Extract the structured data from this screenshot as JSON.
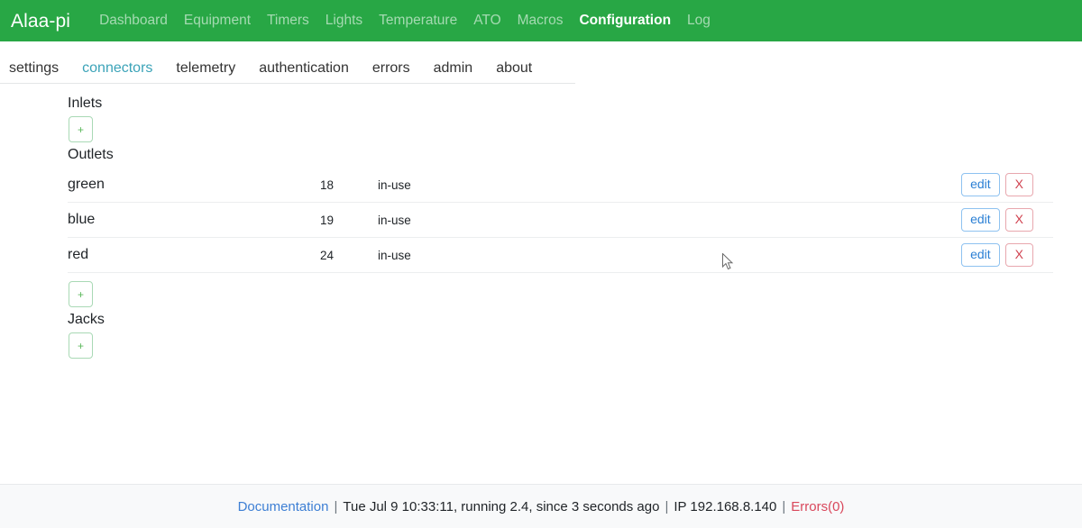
{
  "app": {
    "brand": "Alaa-pi",
    "accent_green": "#28a745",
    "link_blue": "#3d7fd4",
    "error_red": "#d9485c",
    "tab_active_teal": "#3ba3b8"
  },
  "navbar": {
    "items": [
      {
        "label": "Dashboard",
        "active": false
      },
      {
        "label": "Equipment",
        "active": false
      },
      {
        "label": "Timers",
        "active": false
      },
      {
        "label": "Lights",
        "active": false
      },
      {
        "label": "Temperature",
        "active": false
      },
      {
        "label": "ATO",
        "active": false
      },
      {
        "label": "Macros",
        "active": false
      },
      {
        "label": "Configuration",
        "active": true
      },
      {
        "label": "Log",
        "active": false
      }
    ]
  },
  "subtabs": {
    "items": [
      {
        "label": "settings",
        "active": false
      },
      {
        "label": "connectors",
        "active": true
      },
      {
        "label": "telemetry",
        "active": false
      },
      {
        "label": "authentication",
        "active": false
      },
      {
        "label": "errors",
        "active": false
      },
      {
        "label": "admin",
        "active": false
      },
      {
        "label": "about",
        "active": false
      }
    ]
  },
  "main": {
    "inlets": {
      "title": "Inlets",
      "add_label": "+"
    },
    "outlets": {
      "title": "Outlets",
      "add_label": "+",
      "rows": [
        {
          "name": "green",
          "pin": "18",
          "status": "in-use",
          "edit_label": "edit",
          "delete_label": "X"
        },
        {
          "name": "blue",
          "pin": "19",
          "status": "in-use",
          "edit_label": "edit",
          "delete_label": "X"
        },
        {
          "name": "red",
          "pin": "24",
          "status": "in-use",
          "edit_label": "edit",
          "delete_label": "X"
        }
      ]
    },
    "jacks": {
      "title": "Jacks",
      "add_label": "+"
    }
  },
  "footer": {
    "doc_link": "Documentation",
    "separator": "|",
    "status": "Tue Jul 9 10:33:11,  running 2.4,  since 3 seconds ago",
    "ip": "IP 192.168.8.140",
    "errors": "Errors(0)"
  }
}
